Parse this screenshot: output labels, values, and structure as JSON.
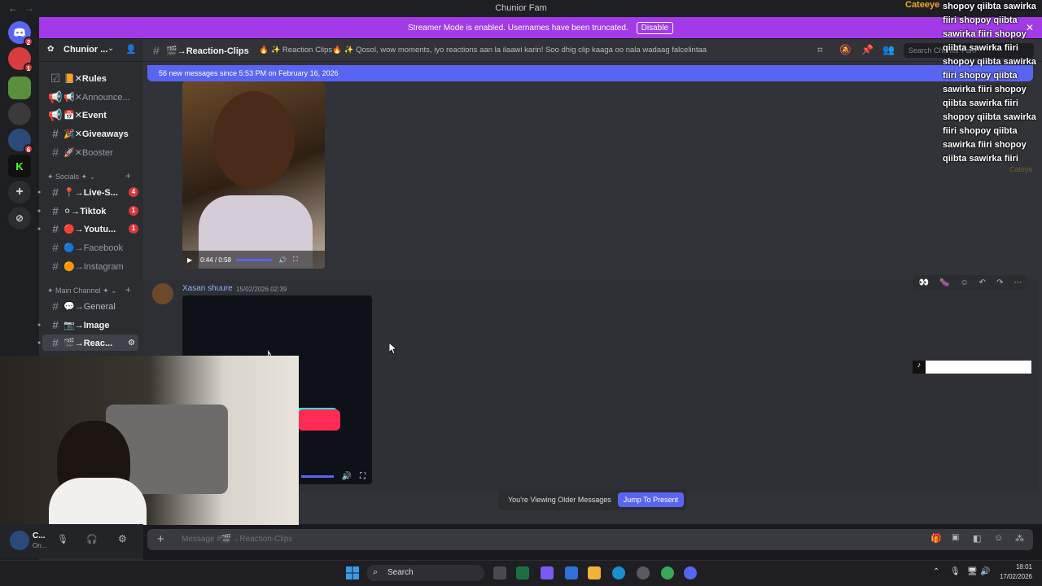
{
  "window": {
    "title": "Chunior Fam",
    "back": "←",
    "forward": "→"
  },
  "top_right_overlay": {
    "username": "Cateeye",
    "chat_text": "shopoy qiibta sawirka fiiri shopoy qiibta sawirka fiiri shopoy qiibta sawirka fiiri shopoy qiibta sawirka fiiri shopoy qiibta sawirka fiiri shopoy qiibta sawirka fiiri shopoy qiibta sawirka fiiri shopoy qiibta sawirka fiiri shopoy qiibta sawirka fiiri",
    "faded_name": "Cateye"
  },
  "streamer_banner": {
    "text": "Streamer Mode is enabled. Usernames have been truncated.",
    "button": "Disable"
  },
  "server": {
    "name": "Chunior ..."
  },
  "servers": [
    {
      "name": "discord-home-icon",
      "badge": "2"
    },
    {
      "name": "server-red",
      "badge": "1"
    },
    {
      "name": "server-game",
      "badge": ""
    },
    {
      "name": "server-dark",
      "badge": ""
    },
    {
      "name": "server-chunior",
      "badge": "6"
    },
    {
      "name": "server-kick",
      "badge": ""
    }
  ],
  "channels": [
    {
      "label": "📙✕Rules",
      "bold": true,
      "count": ""
    },
    {
      "label": "📢✕Announce...",
      "bold": false,
      "count": ""
    },
    {
      "label": "📅✕Event",
      "bold": true,
      "count": ""
    },
    {
      "label": "🎉✕Giveaways",
      "bold": true,
      "count": ""
    },
    {
      "label": "🚀✕Booster",
      "bold": false,
      "count": ""
    }
  ],
  "categories": {
    "socials": "✦ Socials ✦",
    "main": "✦ Main Channel ✦"
  },
  "social_channels": [
    {
      "label": "📍→Live-S...",
      "count": "4"
    },
    {
      "label": "⚪→Tiktok",
      "count": "1"
    },
    {
      "label": "🔴→Youtu...",
      "count": "1"
    },
    {
      "label": "🔵→Facebook",
      "count": ""
    },
    {
      "label": "🟠→Instagram",
      "count": ""
    }
  ],
  "main_channels": [
    {
      "label": "💬→General"
    },
    {
      "label": "📷→Image"
    },
    {
      "label": "🎬→Reac..."
    }
  ],
  "channel_header": {
    "name": "🎬→Reaction-Clips",
    "topic": "🔥 ✨ Reaction Clips🔥 ✨ Qosol, wow moments, iyo reactions aan la ilaawi karin! Soo dhig clip kaaga oo nala wadaag falcelintaada 😆",
    "search_placeholder": "Search Chunior Fam"
  },
  "new_messages_bar": "56 new messages since 5:53 PM on February 16, 2026",
  "video1": {
    "time": "0:44 / 0:58"
  },
  "message": {
    "author": "Xasan shuure",
    "timestamp": "15/02/2026 02:39"
  },
  "older_banner": {
    "text": "You're Viewing Older Messages",
    "button": "Jump To Present"
  },
  "composer": {
    "placeholder": "Message #🎬→Reaction-Clips"
  },
  "user": {
    "name": "C...",
    "status": "On..."
  },
  "taskbar": {
    "search": "Search",
    "time": "18:01",
    "date": "17/02/2026"
  },
  "colors": {
    "accent": "#5865f2",
    "streamer": "#a23ae8",
    "badge": "#da373c"
  }
}
